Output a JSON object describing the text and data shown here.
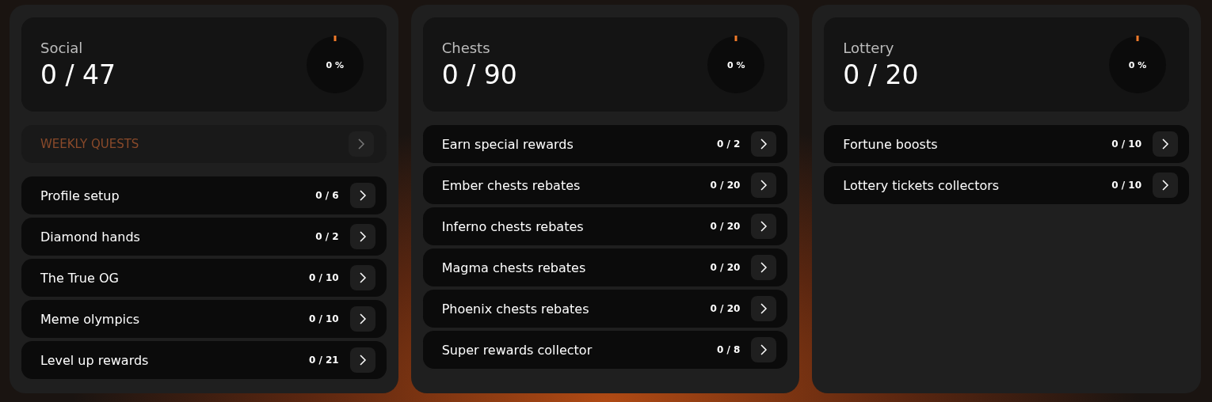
{
  "cards": [
    {
      "title": "Social",
      "count": "0 / 47",
      "percent": "0 %",
      "banner": {
        "label": "WEEKLY QUESTS",
        "disabled": true
      },
      "quests": [
        {
          "label": "Profile setup",
          "count": "0 / 6"
        },
        {
          "label": "Diamond hands",
          "count": "0 / 2"
        },
        {
          "label": "The True OG",
          "count": "0 / 10"
        },
        {
          "label": "Meme olympics",
          "count": "0 / 10"
        },
        {
          "label": "Level up rewards",
          "count": "0 / 21"
        }
      ]
    },
    {
      "title": "Chests",
      "count": "0 / 90",
      "percent": "0 %",
      "quests": [
        {
          "label": "Earn special rewards",
          "count": "0 / 2"
        },
        {
          "label": "Ember chests rebates",
          "count": "0 / 20"
        },
        {
          "label": "Inferno chests rebates",
          "count": "0 / 20"
        },
        {
          "label": "Magma chests rebates",
          "count": "0 / 20"
        },
        {
          "label": "Phoenix chests rebates",
          "count": "0 / 20"
        },
        {
          "label": "Super rewards collector",
          "count": "0 / 8"
        }
      ]
    },
    {
      "title": "Lottery",
      "count": "0 / 20",
      "percent": "0 %",
      "quests": [
        {
          "label": "Fortune boosts",
          "count": "0 / 10"
        },
        {
          "label": "Lottery tickets collectors",
          "count": "0 / 10"
        }
      ]
    }
  ]
}
